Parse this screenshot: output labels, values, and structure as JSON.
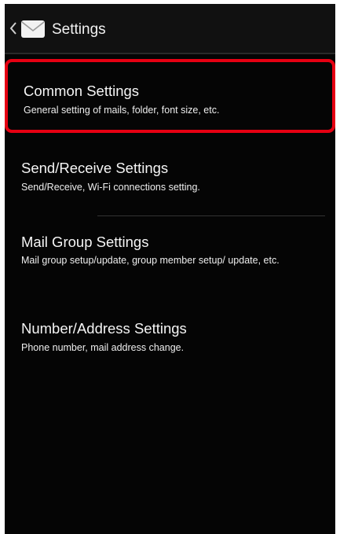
{
  "action_bar": {
    "title": "Settings"
  },
  "settings_items": [
    {
      "title": "Common Settings",
      "subtitle": "General setting of mails, folder, font size, etc."
    },
    {
      "title": "Send/Receive Settings",
      "subtitle": "Send/Receive, Wi-Fi connections setting."
    },
    {
      "title": "Mail Group Settings",
      "subtitle": "Mail group setup/update, group member setup/ update, etc."
    },
    {
      "title": "Number/Address Settings",
      "subtitle": "Phone number, mail address change."
    }
  ],
  "colors": {
    "screen_background": "#050505",
    "highlight_border": "#e60012",
    "text": "#f5f5f5"
  },
  "icons": {
    "back": "chevron-left-icon",
    "app": "mail-envelope-icon"
  }
}
